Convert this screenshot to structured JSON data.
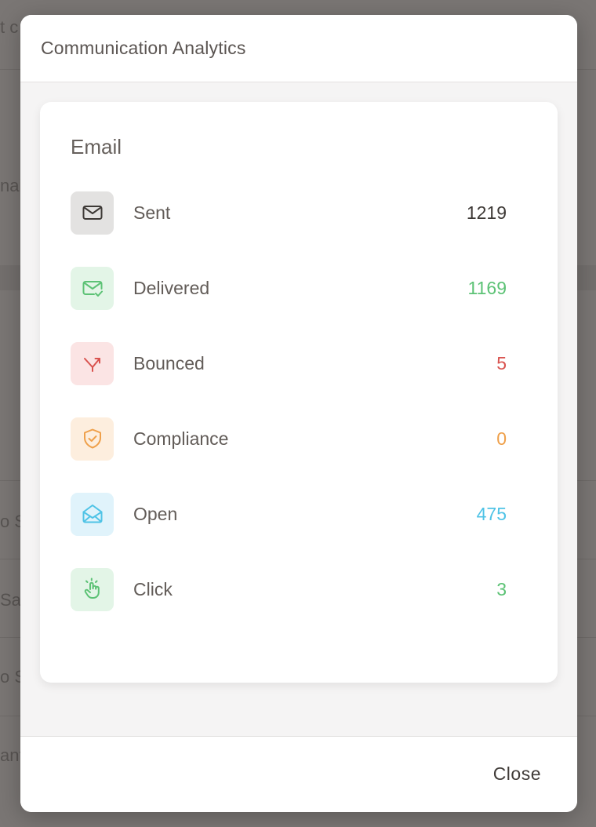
{
  "background": {
    "fragments": [
      "t c",
      "nai",
      "o S",
      "Sa",
      "o S",
      "ant"
    ]
  },
  "modal": {
    "title": "Communication Analytics",
    "close_label": "Close"
  },
  "email": {
    "title": "Email",
    "rows": [
      {
        "label": "Sent",
        "value": "1219",
        "icon": "mail-icon",
        "color": "#3d3936",
        "bg": "#e3e2e1"
      },
      {
        "label": "Delivered",
        "value": "1169",
        "icon": "mail-check-icon",
        "color": "#5cc275",
        "bg": "#e3f5e7"
      },
      {
        "label": "Bounced",
        "value": "5",
        "icon": "bounce-arrow-icon",
        "color": "#d9534f",
        "bg": "#fbe4e4"
      },
      {
        "label": "Compliance",
        "value": "0",
        "icon": "shield-check-icon",
        "color": "#efa04a",
        "bg": "#fdeede"
      },
      {
        "label": "Open",
        "value": "475",
        "icon": "mail-open-icon",
        "color": "#4fc3e6",
        "bg": "#e0f3fb"
      },
      {
        "label": "Click",
        "value": "3",
        "icon": "hand-pointer-icon",
        "color": "#5cc275",
        "bg": "#e3f5e7"
      }
    ]
  }
}
